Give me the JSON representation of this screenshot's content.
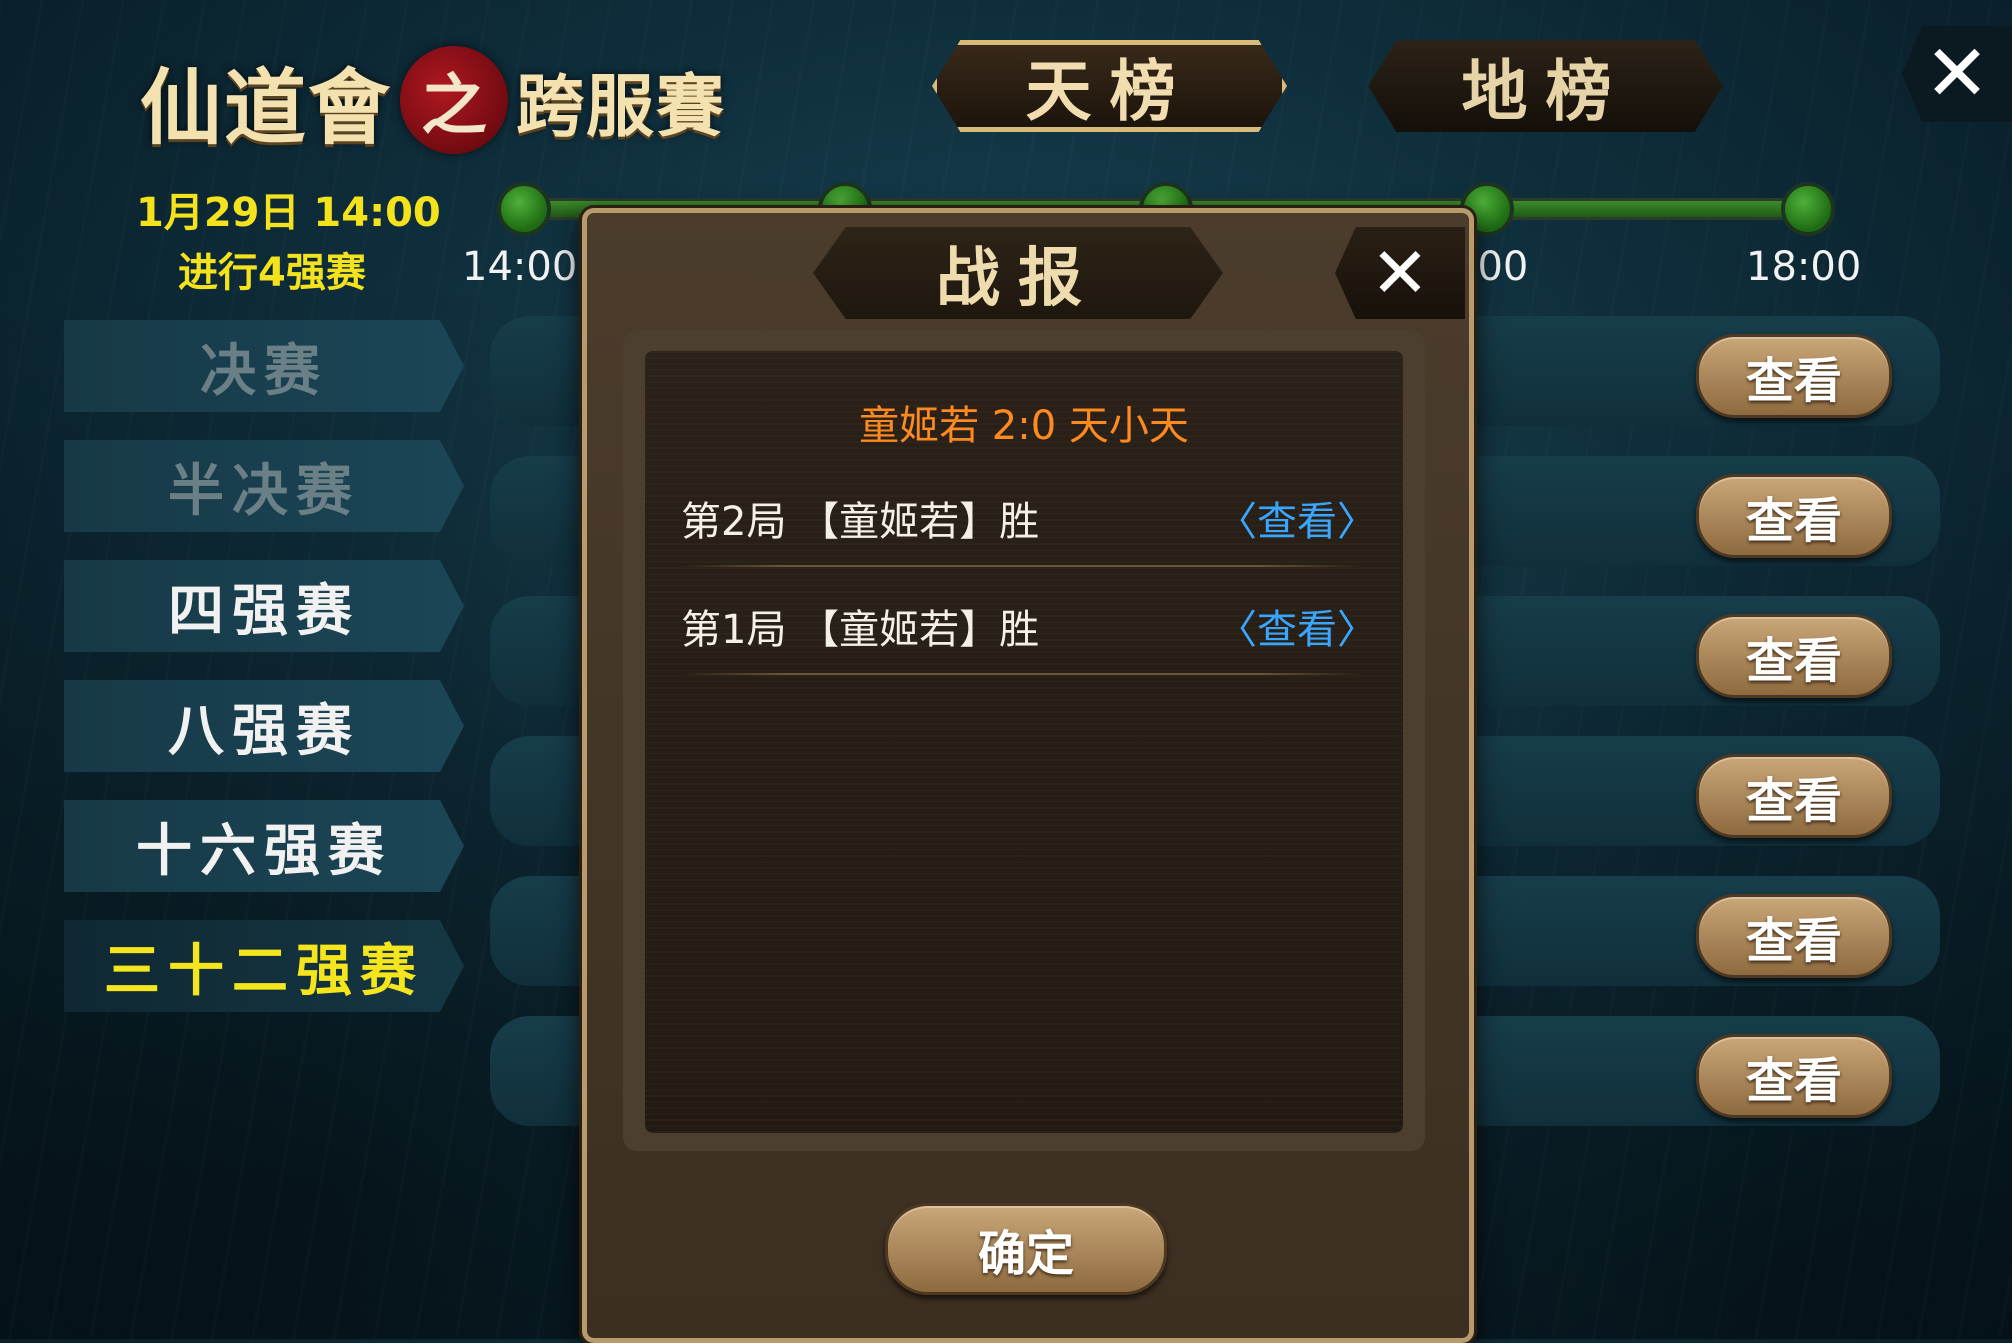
{
  "logo": {
    "part1": "仙道會",
    "seal": "之",
    "part2": "跨服賽"
  },
  "top_tabs": {
    "heaven": "天榜",
    "earth": "地榜"
  },
  "close_symbol": "✕",
  "date": {
    "datetime": "1月29日 14:00",
    "status": "进行4强赛"
  },
  "timeline": {
    "nodes": 5,
    "labels": {
      "start": "14:00",
      "partial": ":00",
      "end": "18:00"
    }
  },
  "stages": [
    "决赛",
    "半决赛",
    "四强赛",
    "八强赛",
    "十六强赛",
    "三十二强赛"
  ],
  "view_label": "查看",
  "dialog": {
    "title": "战报",
    "score_line": "童姬若  2:0  天小天",
    "rounds": [
      {
        "text": "第2局 【童姬若】胜",
        "link": "〈查看〉"
      },
      {
        "text": "第1局 【童姬若】胜",
        "link": "〈查看〉"
      }
    ],
    "confirm": "确定"
  },
  "colors": {
    "highlight": "#f4e51c",
    "score": "#ff8a1f",
    "link": "#39a6ff"
  }
}
